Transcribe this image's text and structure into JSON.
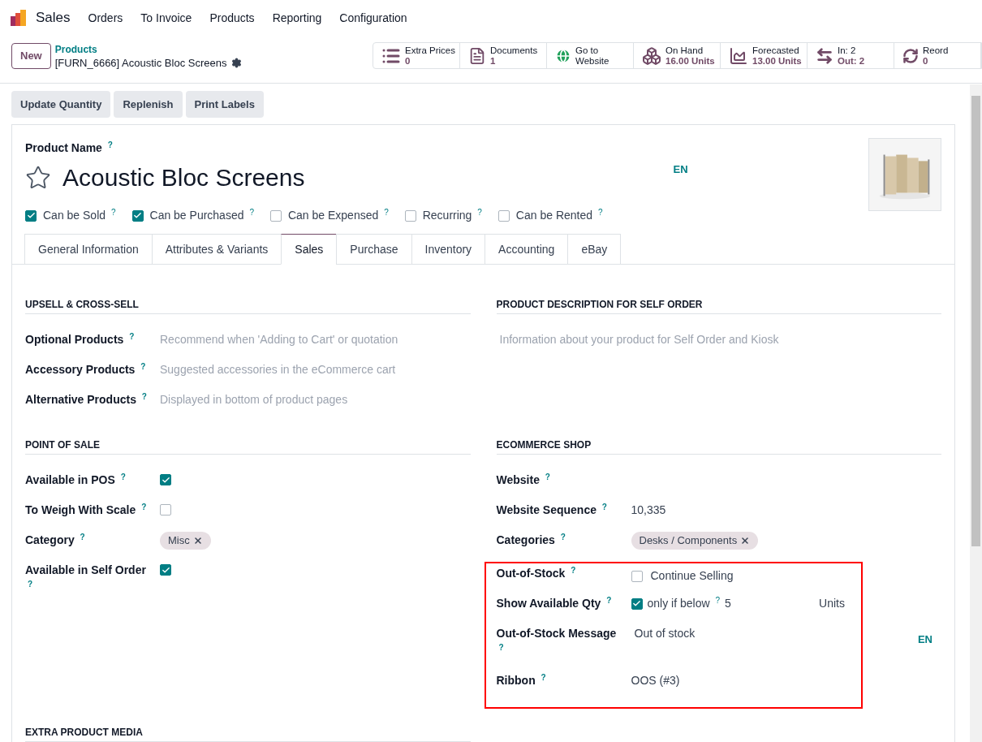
{
  "navbar": {
    "app": "Sales",
    "menu": [
      "Orders",
      "To Invoice",
      "Products",
      "Reporting",
      "Configuration"
    ]
  },
  "control_panel": {
    "new_button": "New",
    "breadcrumb": "Products",
    "record": "[FURN_6666] Acoustic Bloc Screens",
    "stat_buttons": [
      {
        "kind": "list",
        "label": "Extra Prices",
        "value": "0",
        "plain_value": false
      },
      {
        "kind": "document",
        "label": "Documents",
        "value": "1",
        "plain_value": false
      },
      {
        "kind": "globe",
        "label": "Go to",
        "value": "Website",
        "plain_value": true
      },
      {
        "kind": "cubes",
        "label": "On Hand",
        "value": "16.00 Units",
        "plain_value": false
      },
      {
        "kind": "chart",
        "label": "Forecasted",
        "value": "13.00 Units",
        "plain_value": false
      },
      {
        "kind": "transfer",
        "label": "In: 2",
        "value": "Out: 2",
        "plain_value": false
      },
      {
        "kind": "refresh",
        "label": "Reord",
        "value": "0",
        "plain_value": false
      }
    ]
  },
  "actions": [
    "Update Quantity",
    "Replenish",
    "Print Labels"
  ],
  "product": {
    "name_label": "Product Name $^{?}$",
    "name": "Acoustic Bloc Screens",
    "favorite": false,
    "lang": "EN",
    "options": [
      {
        "label": "Can be Sold $^{?}$",
        "checked": true
      },
      {
        "label": "Can be Purchased $^{?}$",
        "checked": true
      },
      {
        "label": "Can be Expensed $^{?}$",
        "checked": false
      },
      {
        "label": "Recurring $^{?}$",
        "checked": false
      },
      {
        "label": "Can be Rented $^{?}$",
        "checked": false
      }
    ]
  },
  "tabs": [
    {
      "label": "General Information",
      "selected": false
    },
    {
      "label": "Attributes & Variants",
      "selected": false
    },
    {
      "label": "Sales",
      "selected": true
    },
    {
      "label": "Purchase",
      "selected": false
    },
    {
      "label": "Inventory",
      "selected": false
    },
    {
      "label": "Accounting",
      "selected": false
    },
    {
      "label": "eBay",
      "selected": false
    }
  ],
  "section_rows": [
    {
      "sections": [
        {
          "title": "UPSELL & CROSS-SELL",
          "fields": [
            {
              "kind": "placeholder",
              "label": "Optional Products $^{?}$",
              "placeholder": "Recommend when 'Adding to Cart' or quotation"
            },
            {
              "kind": "placeholder",
              "label": "Accessory Products $^{?}$",
              "placeholder": "Suggested accessories in the eCommerce cart"
            },
            {
              "kind": "placeholder",
              "label": "Alternative Products $^{?}$",
              "placeholder": "Displayed in bottom of product pages"
            }
          ]
        },
        {
          "title": "PRODUCT DESCRIPTION FOR SELF ORDER",
          "fields": [
            {
              "kind": "note",
              "placeholder": "Information about your product for Self Order and Kiosk"
            }
          ]
        }
      ]
    },
    {
      "sections": [
        {
          "title": "POINT OF SALE",
          "fields": [
            {
              "kind": "checkbox",
              "label": "Available in POS $^{?}$",
              "checked": true
            },
            {
              "kind": "checkbox",
              "label": "To Weigh With Scale $^{?}$",
              "checked": false
            },
            {
              "kind": "tags",
              "label": "Category $^{?}$",
              "tags": [
                "Misc"
              ]
            },
            {
              "kind": "checkbox",
              "label": "Available in Self Order $^{?}$",
              "checked": true
            }
          ]
        },
        {
          "title": "ECOMMERCE SHOP",
          "fields": [
            {
              "kind": "empty",
              "label": "Website $^{?}$"
            },
            {
              "kind": "text",
              "label": "Website Sequence $^{?}$",
              "value": "10,335"
            },
            {
              "kind": "tags",
              "label": "Categories $^{?}$",
              "tags": [
                "Desks / Components"
              ]
            }
          ],
          "highlight": [
            {
              "kind": "checkbox",
              "label": "Out-of-Stock $^{?}$",
              "checked": false,
              "text": "Continue Selling"
            },
            {
              "kind": "threshold",
              "label": "Show Available Qty $^{?}$",
              "checked": true,
              "text": "only if below $^{?}$",
              "value": "5",
              "unit": "Units"
            },
            {
              "kind": "translatable",
              "label": "Out-of-Stock Message $^{?}$",
              "value": "Out of stock",
              "lang": "EN"
            },
            {
              "kind": "text",
              "label": "Ribbon $^{?}$",
              "value": "OOS (#3)"
            }
          ]
        }
      ]
    },
    {
      "sections": [
        {
          "title": "EXTRA PRODUCT MEDIA"
        }
      ]
    }
  ]
}
